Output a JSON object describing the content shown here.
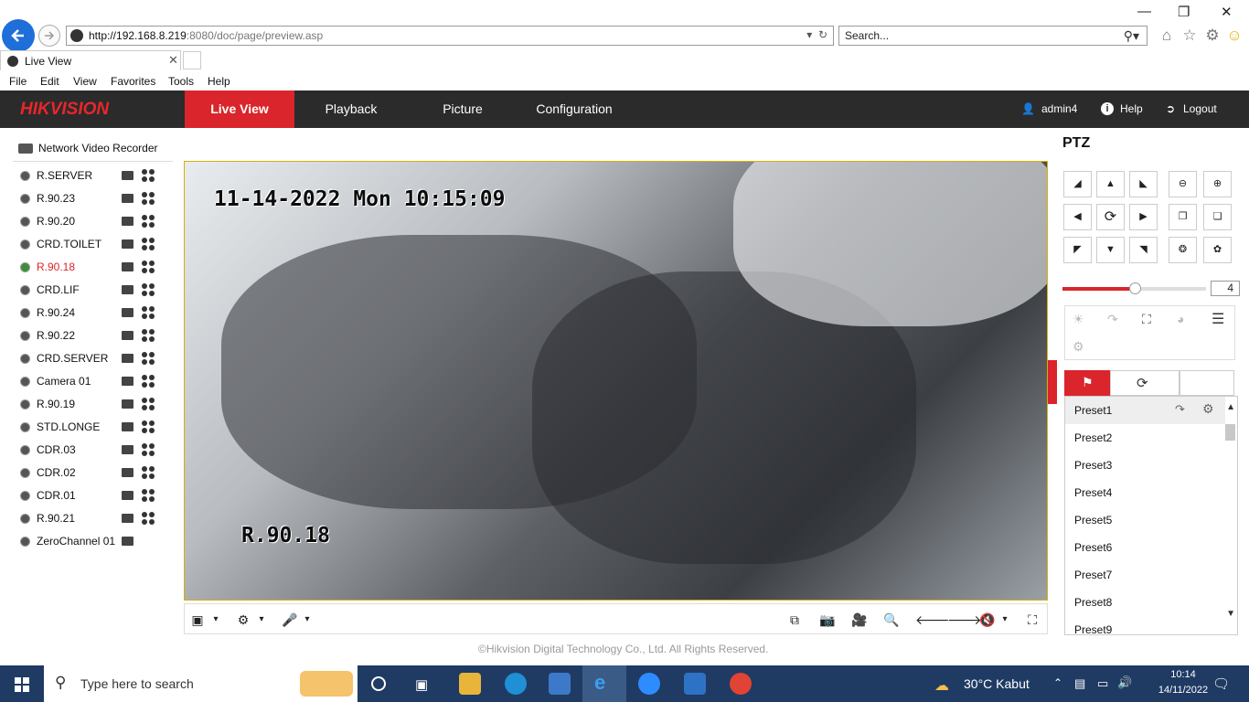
{
  "browser": {
    "address_host": "http://192.168.8.219",
    "address_rest": ":8080/doc/page/preview.asp",
    "search_placeholder": "Search...",
    "tab_title": "Live View",
    "menu": [
      "File",
      "Edit",
      "View",
      "Favorites",
      "Tools",
      "Help"
    ]
  },
  "app": {
    "logo": "HIKVISION",
    "nav": [
      "Live View",
      "Playback",
      "Picture",
      "Configuration"
    ],
    "user": "admin4",
    "help": "Help",
    "logout": "Logout"
  },
  "device_tree": {
    "root": "Network Video Recorder",
    "cameras": [
      {
        "name": "R.SERVER",
        "selected": false
      },
      {
        "name": "R.90.23",
        "selected": false
      },
      {
        "name": "R.90.20",
        "selected": false
      },
      {
        "name": "CRD.TOILET",
        "selected": false
      },
      {
        "name": "R.90.18",
        "selected": true
      },
      {
        "name": "CRD.LIF",
        "selected": false
      },
      {
        "name": "R.90.24",
        "selected": false
      },
      {
        "name": "R.90.22",
        "selected": false
      },
      {
        "name": "CRD.SERVER",
        "selected": false
      },
      {
        "name": "Camera 01",
        "selected": false
      },
      {
        "name": "R.90.19",
        "selected": false
      },
      {
        "name": "STD.LONGE",
        "selected": false
      },
      {
        "name": "CDR.03",
        "selected": false
      },
      {
        "name": "CDR.02",
        "selected": false
      },
      {
        "name": "CDR.01",
        "selected": false
      },
      {
        "name": "R.90.21",
        "selected": false
      },
      {
        "name": "ZeroChannel 01",
        "selected": false
      }
    ]
  },
  "video": {
    "osd_time": "11-14-2022 Mon 10:15:09",
    "osd_name": "R.90.18"
  },
  "ptz": {
    "title": "PTZ",
    "speed": "4",
    "speed_fraction": 0.5,
    "presets": [
      "Preset1",
      "Preset2",
      "Preset3",
      "Preset4",
      "Preset5",
      "Preset6",
      "Preset7",
      "Preset8",
      "Preset9"
    ]
  },
  "footer": {
    "copyright": "©Hikvision Digital Technology Co., Ltd. All Rights Reserved."
  },
  "taskbar": {
    "search_placeholder": "Type here to search",
    "weather": "30°C  Kabut",
    "time": "10:14",
    "date": "14/11/2022"
  },
  "colors": {
    "accent_red": "#d9252b",
    "header_dark": "#2b2b2b",
    "taskbar": "#1f3b64"
  }
}
